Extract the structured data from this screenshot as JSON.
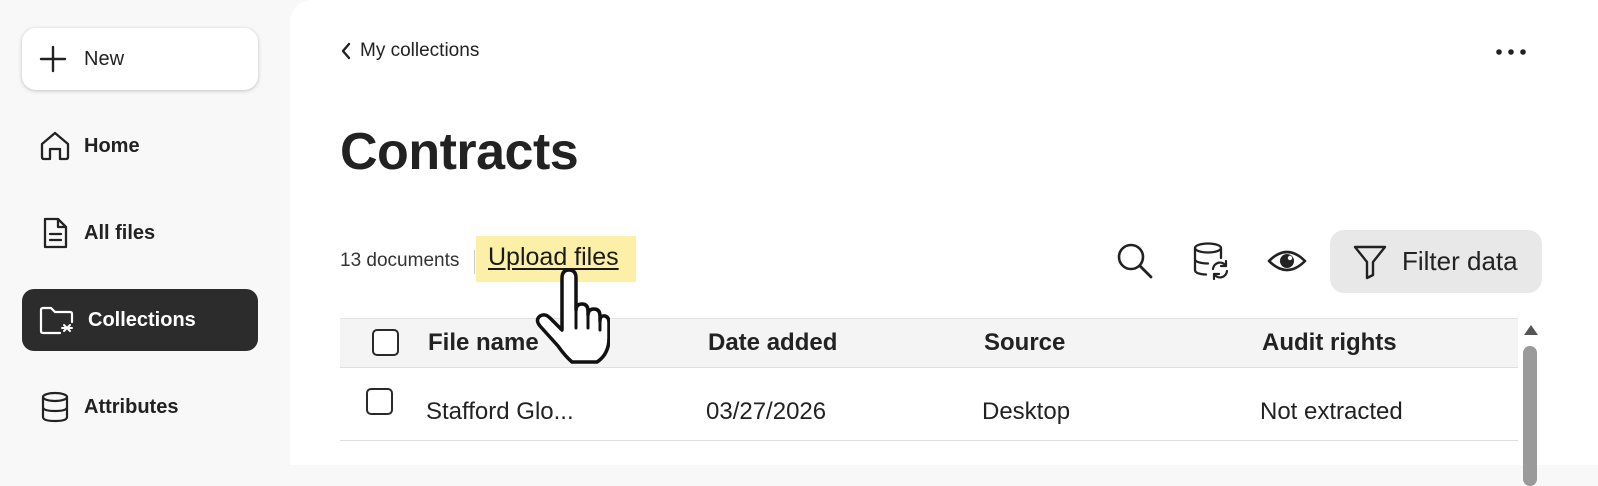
{
  "sidebar": {
    "new_button": {
      "label": "New",
      "icon": "plus-icon"
    },
    "items": [
      {
        "label": "Home",
        "icon": "home-icon",
        "active": false
      },
      {
        "label": "All files",
        "icon": "file-icon",
        "active": false
      },
      {
        "label": "Collections",
        "icon": "folder-collections-icon",
        "active": true
      },
      {
        "label": "Attributes",
        "icon": "database-icon",
        "active": false
      }
    ]
  },
  "main": {
    "back_link": {
      "label": "My collections",
      "icon": "chevron-left-icon"
    },
    "more_icon": "more-horizontal-icon",
    "title": "Contracts",
    "toolbar": {
      "doc_count": "13 documents",
      "upload_label": "Upload files",
      "icons": [
        "search-icon",
        "database-sync-icon",
        "eye-icon"
      ],
      "filter_label": "Filter data",
      "filter_icon": "filter-icon"
    },
    "table": {
      "columns": [
        "File name",
        "Date added",
        "Source",
        "Audit rights"
      ],
      "rows": [
        {
          "file_name": "Stafford Glo...",
          "date_added": "03/27/2026",
          "source": "Desktop",
          "audit_rights": "Not extracted"
        }
      ]
    }
  },
  "colors": {
    "active_nav_bg": "#2c2c2c",
    "upload_highlight": "#fcefa8",
    "filter_button_bg": "#e8e8e8",
    "sidebar_bg": "#f8f8f8"
  }
}
